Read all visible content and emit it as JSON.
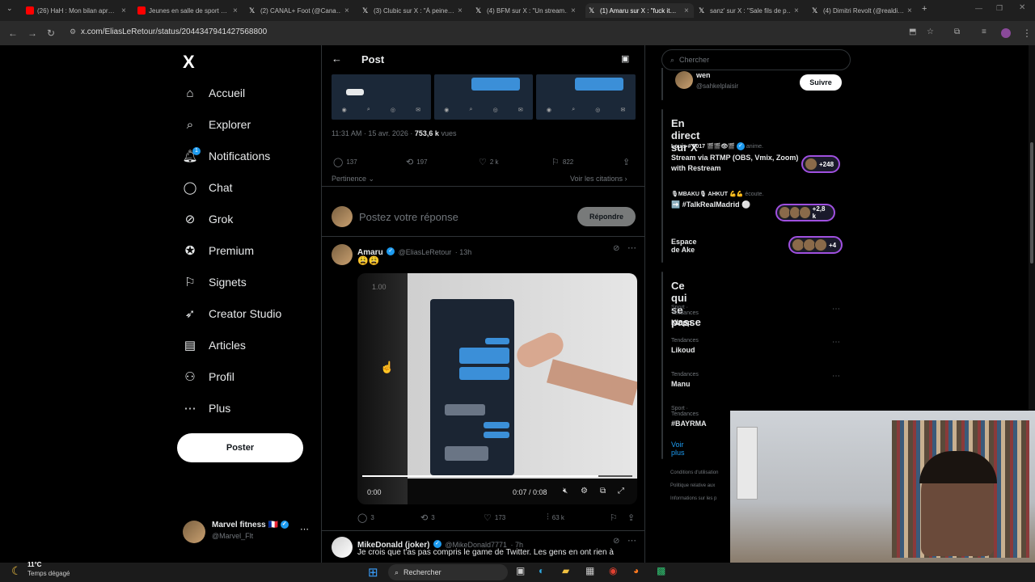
{
  "browser": {
    "tabs": [
      {
        "title": "(26) HaH : Mon bilan apr…",
        "color": "#ff0000"
      },
      {
        "title": "Jeunes en salle de sport …",
        "color": "#ff0000"
      },
      {
        "title": "(2) CANAL+ Foot (@Cana…",
        "color": "#ffffff"
      },
      {
        "title": "(3) Clubic sur X : \"À peine…",
        "color": "#ffffff"
      },
      {
        "title": "(4) BFM sur X : \"Un stream…",
        "color": "#ffffff"
      },
      {
        "title": "(1) Amaru sur X : \"fuck it…",
        "color": "#ffffff"
      },
      {
        "title": "sanz' sur X : \"Sale fils de p…",
        "color": "#ffffff"
      },
      {
        "title": "(4) Dimitri Revolt (@realdi…",
        "color": "#ffffff"
      }
    ],
    "url": "x.com/EliasLeRetour/status/2044347941427568800"
  },
  "sidebar": {
    "logo": "X",
    "items": [
      {
        "label": "Accueil",
        "icon": "home-icon"
      },
      {
        "label": "Explorer",
        "icon": "search-icon"
      },
      {
        "label": "Notifications",
        "icon": "bell-icon",
        "badge": "1"
      },
      {
        "label": "Chat",
        "icon": "chat-icon"
      },
      {
        "label": "Grok",
        "icon": "grok-icon"
      },
      {
        "label": "Premium",
        "icon": "premium-icon"
      },
      {
        "label": "Signets",
        "icon": "bookmark-icon"
      },
      {
        "label": "Creator Studio",
        "icon": "rocket-icon"
      },
      {
        "label": "Articles",
        "icon": "article-icon"
      },
      {
        "label": "Profil",
        "icon": "person-icon"
      },
      {
        "label": "Plus",
        "icon": "more-icon"
      }
    ],
    "post_button": "Poster",
    "account": {
      "name": "Marvel fitness 🇫🇷",
      "handle": "@Marvel_Flt"
    }
  },
  "post": {
    "header": "Post",
    "timestamp": "11:31 AM · 15 avr. 2026 · ",
    "views": "753,6 k",
    "views_label": " vues",
    "stats": {
      "replies": "137",
      "reposts": "197",
      "likes": "2 k",
      "bookmarks": "822"
    },
    "sort": "Pertinence",
    "quotes": "Voir les citations",
    "reply_placeholder": "Postez votre réponse",
    "reply_button": "Répondre"
  },
  "reply": {
    "name": "Amaru",
    "handle": "@EliasLeRetour",
    "time": "· 13h",
    "text": "😩😩",
    "video": {
      "speed": "1.00",
      "elapsed": "0:00",
      "timer": "0:07 / 0:08",
      "progress": 0.875
    },
    "stats": {
      "replies": "3",
      "reposts": "3",
      "likes": "173",
      "views": "63 k"
    }
  },
  "reply2": {
    "name": "MikeDonald (joker)",
    "handle": "@MikeDonald7771",
    "time": "· 7h",
    "text": "Je crois que t'as pas compris le game de Twitter. Les gens en ont rien à"
  },
  "right": {
    "search_placeholder": "Chercher",
    "follow_user": {
      "name": "wen",
      "handle": "@sahkelplaisir",
      "button": "Suivre"
    },
    "live": {
      "title": "En direct sur X",
      "items": [
        {
          "host": "Louis # 5017 🎬🎬👁🎬",
          "status": "anime.",
          "title": "Stream via RTMP (OBS, Vmix, Zoom) with Restream",
          "count": "+248"
        },
        {
          "host": "🎙MBAKU🎙 AHKUT 💪💪",
          "status": "écoute.",
          "title": "➡️ #TalkRealMadrid ⚪",
          "count": "+2,8 k"
        },
        {
          "host": "",
          "status": "",
          "title": "Espace de Ake",
          "count": "+4"
        }
      ]
    },
    "trends": {
      "title": "Ce qui se passe",
      "items": [
        {
          "category": "Sport · Tendances",
          "name": "Klopp"
        },
        {
          "category": "Tendances",
          "name": "Likoud"
        },
        {
          "category": "Tendances",
          "name": "Manu"
        },
        {
          "category": "Sport · Tendances",
          "name": "#BAYRMA"
        }
      ],
      "more": "Voir plus"
    },
    "footer": [
      "Conditions d'utilisation",
      "Politique relative aux",
      "Informations sur les p"
    ]
  },
  "taskbar": {
    "temp": "11°C",
    "weather": "Temps dégagé",
    "search": "Rechercher"
  },
  "colors": {
    "accent": "#1d9bf0",
    "bg": "#000000",
    "border": "#2f3336",
    "muted": "#71767b",
    "space_ring": "#a050e0"
  }
}
